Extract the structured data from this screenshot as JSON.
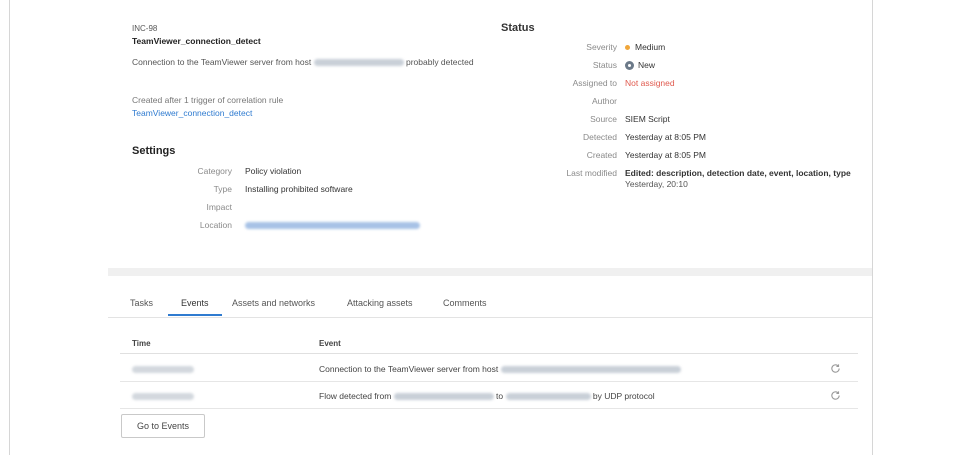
{
  "incident": {
    "id": "INC-98",
    "title": "TeamViewer_connection_detect",
    "description_pre": "Connection to the TeamViewer server from host",
    "description_post": "probably detected",
    "created_text": "Created after 1 trigger of correlation rule",
    "rule_link": "TeamViewer_connection_detect"
  },
  "settings": {
    "title": "Settings",
    "rows": [
      {
        "key": "Category",
        "value": "Policy violation"
      },
      {
        "key": "Type",
        "value": "Installing prohibited software"
      },
      {
        "key": "Impact",
        "value": ""
      },
      {
        "key": "Location",
        "value": ""
      }
    ]
  },
  "status": {
    "title": "Status",
    "severity_key": "Severity",
    "severity_value": "Medium",
    "status_key": "Status",
    "status_value": "New",
    "assigned_key": "Assigned to",
    "assigned_value": "Not assigned",
    "author_key": "Author",
    "author_value": "",
    "source_key": "Source",
    "source_value": "SIEM Script",
    "detected_key": "Detected",
    "detected_value": "Yesterday at 8:05 PM",
    "created_key": "Created",
    "created_value": "Yesterday at 8:05 PM",
    "modified_key": "Last modified",
    "modified_value": "Edited: description, detection date, event, location, type",
    "modified_date": "Yesterday, 20:10"
  },
  "tabs": [
    "Tasks",
    "Events",
    "Assets and networks",
    "Attacking assets",
    "Comments"
  ],
  "events_table": {
    "headers": [
      "Time",
      "Event"
    ],
    "rows": [
      {
        "event_pre": "Connection to the TeamViewer server from host",
        "event_post": ""
      },
      {
        "event_pre": "Flow detected from",
        "event_mid": "to",
        "event_post": "by UDP protocol"
      }
    ]
  },
  "go_to_events": "Go to Events",
  "colors": {
    "accent": "#2f7bd0",
    "severity_medium": "#f0a63a",
    "unassigned": "#e05a4e"
  }
}
